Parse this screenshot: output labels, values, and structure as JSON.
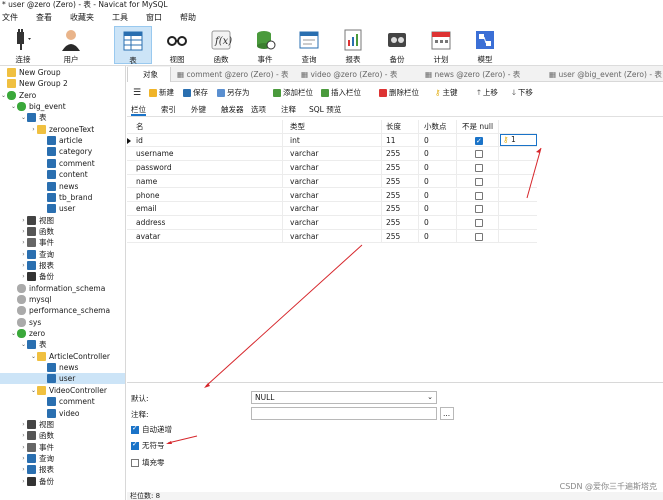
{
  "window": {
    "title": "* user @zero (Zero) - 表 - Navicat for MySQL"
  },
  "menu": [
    "文件",
    "查看",
    "收藏夹",
    "工具",
    "窗口",
    "帮助"
  ],
  "toolbar": [
    {
      "label": "连接",
      "icon": "plug-icon"
    },
    {
      "label": "用户",
      "icon": "user-icon"
    },
    {
      "label": "表",
      "icon": "table-icon"
    },
    {
      "label": "视图",
      "icon": "glasses-icon"
    },
    {
      "label": "函数",
      "icon": "function-icon"
    },
    {
      "label": "事件",
      "icon": "event-icon"
    },
    {
      "label": "查询",
      "icon": "query-icon"
    },
    {
      "label": "报表",
      "icon": "report-icon"
    },
    {
      "label": "备份",
      "icon": "backup-icon"
    },
    {
      "label": "计划",
      "icon": "calendar-icon"
    },
    {
      "label": "模型",
      "icon": "model-icon"
    }
  ],
  "tree": [
    {
      "label": "New Group",
      "kind": "folder"
    },
    {
      "label": "New Group 2",
      "kind": "folder"
    },
    {
      "label": "Zero",
      "kind": "connection"
    },
    {
      "label": "big_event",
      "kind": "database"
    },
    {
      "label": "表",
      "kind": "tables"
    },
    {
      "label": "zerooneText",
      "kind": "folder"
    },
    {
      "label": "article",
      "kind": "table"
    },
    {
      "label": "category",
      "kind": "table"
    },
    {
      "label": "comment",
      "kind": "table"
    },
    {
      "label": "content",
      "kind": "table"
    },
    {
      "label": "news",
      "kind": "table"
    },
    {
      "label": "tb_brand",
      "kind": "table"
    },
    {
      "label": "user",
      "kind": "table"
    },
    {
      "label": "视图",
      "kind": "views"
    },
    {
      "label": "函数",
      "kind": "functions"
    },
    {
      "label": "事件",
      "kind": "events"
    },
    {
      "label": "查询",
      "kind": "queries"
    },
    {
      "label": "报表",
      "kind": "reports"
    },
    {
      "label": "备份",
      "kind": "backups"
    },
    {
      "label": "information_schema",
      "kind": "db-gray"
    },
    {
      "label": "mysql",
      "kind": "db-gray"
    },
    {
      "label": "performance_schema",
      "kind": "db-gray"
    },
    {
      "label": "sys",
      "kind": "db-gray"
    },
    {
      "label": "zero",
      "kind": "database"
    },
    {
      "label": "表",
      "kind": "tables"
    },
    {
      "label": "ArticleController",
      "kind": "folder"
    },
    {
      "label": "news",
      "kind": "table"
    },
    {
      "label": "user",
      "kind": "table"
    },
    {
      "label": "VideoController",
      "kind": "folder"
    },
    {
      "label": "comment",
      "kind": "table"
    },
    {
      "label": "video",
      "kind": "table"
    },
    {
      "label": "视图",
      "kind": "views"
    },
    {
      "label": "函数",
      "kind": "functions"
    },
    {
      "label": "事件",
      "kind": "events"
    },
    {
      "label": "查询",
      "kind": "queries"
    },
    {
      "label": "报表",
      "kind": "reports"
    },
    {
      "label": "备份",
      "kind": "backups"
    }
  ],
  "tabs": [
    "对象",
    "comment @zero (Zero) - 表",
    "video @zero (Zero) - 表",
    "news @zero (Zero) - 表",
    "user @big_event (Zero) - 表"
  ],
  "object_toolbar": {
    "new": "新建",
    "save": "保存",
    "save_as": "另存为",
    "add_field": "添加栏位",
    "insert_field": "插入栏位",
    "delete_field": "删除栏位",
    "primary_key": "主键",
    "move_up": "上移",
    "move_down": "下移"
  },
  "subtabs": [
    "栏位",
    "索引",
    "外键",
    "触发器",
    "选项",
    "注释",
    "SQL 预览"
  ],
  "grid": {
    "headers": [
      "名",
      "类型",
      "长度",
      "小数点",
      "不是 null"
    ],
    "rows": [
      {
        "name": "id",
        "type": "int",
        "length": "11",
        "decimals": "0",
        "not_null": true,
        "key": "1"
      },
      {
        "name": "username",
        "type": "varchar",
        "length": "255",
        "decimals": "0",
        "not_null": false
      },
      {
        "name": "password",
        "type": "varchar",
        "length": "255",
        "decimals": "0",
        "not_null": false
      },
      {
        "name": "name",
        "type": "varchar",
        "length": "255",
        "decimals": "0",
        "not_null": false
      },
      {
        "name": "phone",
        "type": "varchar",
        "length": "255",
        "decimals": "0",
        "not_null": false
      },
      {
        "name": "email",
        "type": "varchar",
        "length": "255",
        "decimals": "0",
        "not_null": false
      },
      {
        "name": "address",
        "type": "varchar",
        "length": "255",
        "decimals": "0",
        "not_null": false
      },
      {
        "name": "avatar",
        "type": "varchar",
        "length": "255",
        "decimals": "0",
        "not_null": false
      }
    ]
  },
  "props": {
    "default_label": "默认:",
    "default_value": "NULL",
    "comment_label": "注释:",
    "comment_value": "",
    "ellipsis": "...",
    "auto_increment": {
      "label": "自动递增",
      "checked": true
    },
    "unsigned": {
      "label": "无符号",
      "checked": true
    },
    "zerofill": {
      "label": "填充零",
      "checked": false
    }
  },
  "status": {
    "field_count": "栏位数: 8"
  },
  "watermark": "CSDN @爱你三千遍斯塔克",
  "colors": {
    "accent": "#1a73c8",
    "selection": "#cce4f7",
    "arrow": "#d6262b"
  }
}
